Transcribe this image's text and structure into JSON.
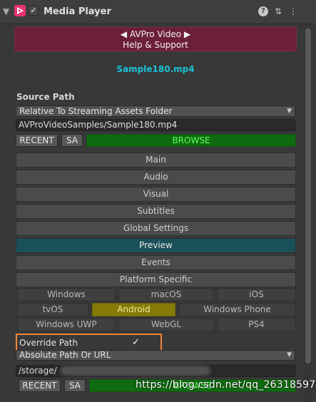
{
  "header": {
    "fold_glyph": "▼",
    "title": "Media Player",
    "checkbox": "✓",
    "help": "?",
    "settings": "⇅",
    "menu": "⋮"
  },
  "banner": {
    "line1": "◀ AVPro Video ▶",
    "line2": "Help & Support"
  },
  "media": {
    "filename": "Sample180.mp4"
  },
  "source": {
    "label": "Source Path",
    "location": "Relative To Streaming Assets Folder",
    "path": "AVProVideoSamples/Sample180.mp4",
    "recent": "RECENT",
    "sa": "SA",
    "browse": "BROWSE"
  },
  "sections": [
    "Main",
    "Audio",
    "Visual",
    "Subtitles",
    "Global Settings",
    "Preview",
    "Events",
    "Platform Specific"
  ],
  "platforms": [
    "Windows",
    "macOS",
    "iOS",
    "tvOS",
    "Android",
    "Windows Phone",
    "Windows UWP",
    "WebGL",
    "PS4"
  ],
  "override": {
    "label": "Override Path",
    "check": "✓",
    "location": "Absolute Path Or URL",
    "path": "/storage/",
    "recent": "RECENT",
    "sa": "SA",
    "browse": "BROWSE"
  },
  "watermark": "https://blog.csdn.net/qq_26318597",
  "colors": {
    "accent_banner": "#6d1f37",
    "filename": "#19c3d6",
    "browse": "#0f6b10",
    "preview_tab": "#1a5158",
    "android_selected": "#857a05",
    "highlight": "#f0863b"
  }
}
